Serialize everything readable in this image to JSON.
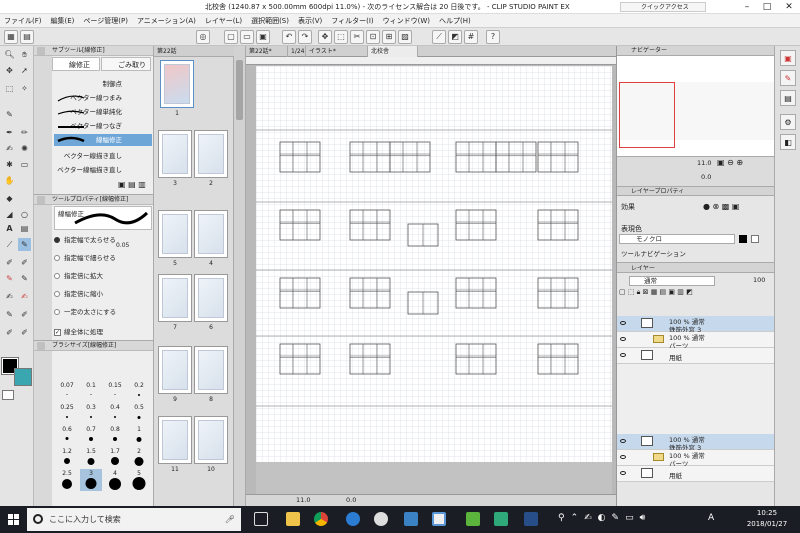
{
  "window": {
    "title": "北校舎 (1240.87 x 500.00mm 600dpi 11.0%)  - 次のライセンス解合は 20 日後です。 - CLIP STUDIO PAINT EX",
    "quick_access": "クイックアクセス"
  },
  "menu": [
    "ファイル(F)",
    "編集(E)",
    "ページ管理(P)",
    "アニメーション(A)",
    "レイヤー(L)",
    "選択範囲(S)",
    "表示(V)",
    "フィルター(I)",
    "ウィンドウ(W)",
    "ヘルプ(H)"
  ],
  "sub_tool": {
    "header": "サブツール[線修正]",
    "tabs": [
      "線修正",
      "ごみ取り"
    ],
    "items": [
      "制御点",
      "ベクター線つまみ",
      "ベクター線単純化",
      "ベクター線つなぎ",
      "線幅修正",
      "ベクター線描き直し",
      "ベクター線幅描き直し"
    ],
    "selected": "線幅修正"
  },
  "tool_property": {
    "header": "ツールプロパティ[線幅修正]",
    "title": "線幅修正",
    "value": "0.05",
    "options": [
      "指定幅で太らせる",
      "指定幅で細らせる",
      "指定倍に拡大",
      "指定倍に縮小",
      "一定の太さにする"
    ],
    "selected_option": "指定幅で太らせる",
    "checkbox": "線全体に処理",
    "checkbox_checked": true
  },
  "brush_size": {
    "header": "ブラシサイズ[線幅修正]",
    "sizes": [
      "0.07",
      "0.1",
      "0.15",
      "0.2",
      "0.25",
      "0.3",
      "0.4",
      "0.5",
      "0.6",
      "0.7",
      "0.8",
      "1",
      "1.2",
      "1.5",
      "1.7",
      "2",
      "2.5",
      "3",
      "4",
      "5"
    ],
    "selected": "3"
  },
  "pages": {
    "tab": "第22話",
    "first_label": "1",
    "pairs": [
      [
        "3",
        "2"
      ],
      [
        "5",
        "4"
      ],
      [
        "7",
        "6"
      ],
      [
        "9",
        "8"
      ],
      [
        "11",
        "10"
      ]
    ]
  },
  "canvas": {
    "tabs": [
      "第22話*",
      "1/24",
      "イラスト*",
      "北校舎"
    ],
    "zoom": "11.0",
    "angle": "0.0"
  },
  "navigator": {
    "header": "ナビゲーター",
    "zoom": "11.0",
    "angle": "0.0"
  },
  "layer_property": {
    "header": "レイヤープロパティ",
    "effect_label": "効果",
    "color_label": "表現色",
    "color_value": "モノクロ",
    "tool_nav": "ツールナビゲーション"
  },
  "layers": {
    "header": "レイヤー",
    "blend": "通常",
    "opacity": "100",
    "list_a": [
      {
        "mode": "100 % 通常",
        "name": "鉄筋外窓 3",
        "selected": true
      },
      {
        "mode": "100 % 通常",
        "name": "パーツ",
        "selected": false
      },
      {
        "mode": "",
        "name": "用紙",
        "selected": false
      }
    ],
    "list_b": [
      {
        "mode": "100 % 通常",
        "name": "鉄筋外窓 3",
        "selected": true
      },
      {
        "mode": "100 % 通常",
        "name": "パーツ",
        "selected": false
      },
      {
        "mode": "",
        "name": "用紙",
        "selected": false
      }
    ]
  },
  "taskbar": {
    "search_placeholder": "ここに入力して検索",
    "time": "10:25",
    "date": "2018/01/27",
    "ime": "A"
  },
  "colors": {
    "main_color": "#000000",
    "sub_color": "#3aa6b0",
    "selection": "#6fa6d8",
    "taskbar": "#1a1d24"
  }
}
